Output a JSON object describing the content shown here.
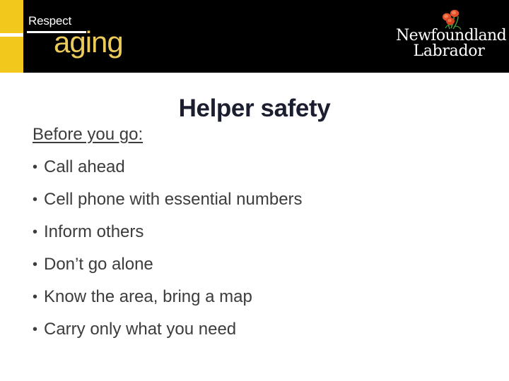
{
  "slide": {
    "title": "Helper safety",
    "title_color": "#1A1E2E",
    "background_color": "#FFFFFF"
  },
  "header": {
    "band_color": "#000000",
    "accent_bar_color": "#F2C81C",
    "brand": {
      "word_top": "Respect",
      "word_top_color": "#FFFFFF",
      "word_bottom": "aging",
      "word_bottom_color": "#EDCB5B"
    },
    "province_logo": {
      "line1": "Newfoundland",
      "line2": "Labrador",
      "text_color": "#FFFFFF",
      "flower_petal_color": "#E2502A",
      "flower_stem_color": "#4E9B3F",
      "icon": "pitcher-plant-flower-icon"
    }
  },
  "content": {
    "lead": "Before you go:",
    "text_color": "#3C3C3C",
    "bullet_glyph": "•",
    "bullets": [
      "Call ahead",
      "Cell phone with essential numbers",
      "Inform others",
      "Don’t go alone",
      "Know the area, bring a map",
      "Carry only what you need"
    ]
  }
}
